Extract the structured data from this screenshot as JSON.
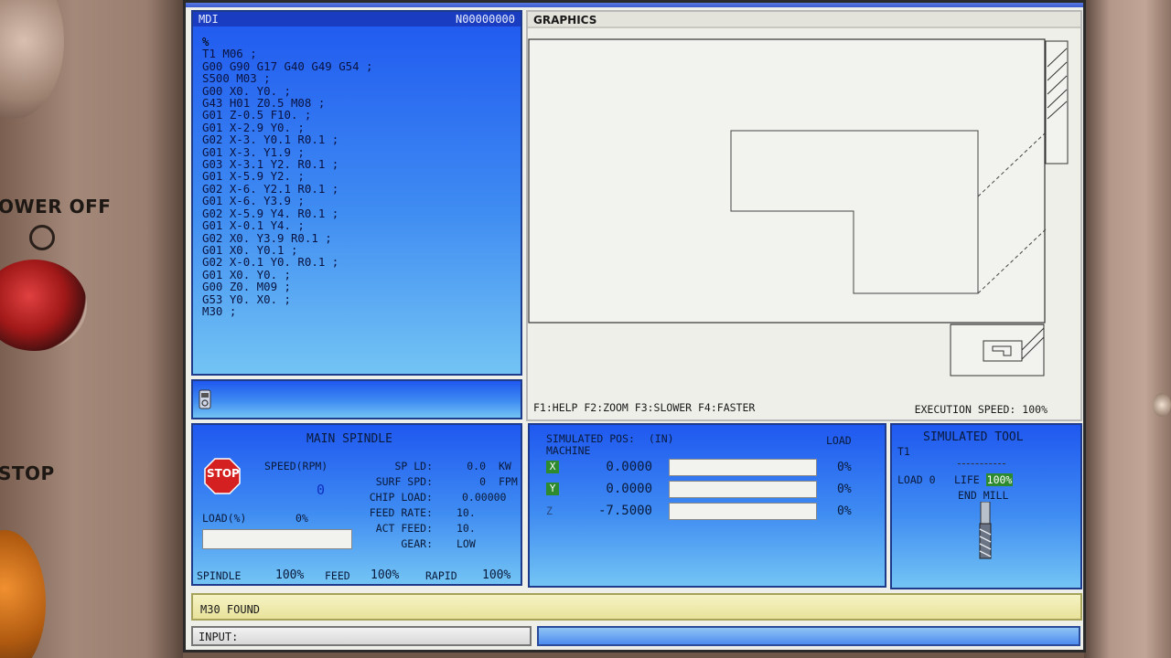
{
  "bezel": {
    "power_off_label": "OWER OFF",
    "stop_label": "STOP"
  },
  "mdi": {
    "title": "MDI",
    "program_number": "N00000000",
    "lines": [
      "%",
      "T1 M06 ;",
      "G00 G90 G17 G40 G49 G54 ;",
      "S500 M03 ;",
      "G00 X0. Y0. ;",
      "G43 H01 Z0.5 M08 ;",
      "G01 Z-0.5 F10. ;",
      "G01 X-2.9 Y0. ;",
      "G02 X-3. Y0.1 R0.1 ;",
      "G01 X-3. Y1.9 ;",
      "G03 X-3.1 Y2. R0.1 ;",
      "G01 X-5.9 Y2. ;",
      "G02 X-6. Y2.1 R0.1 ;",
      "G01 X-6. Y3.9 ;",
      "G02 X-5.9 Y4. R0.1 ;",
      "G01 X-0.1 Y4. ;",
      "G02 X0. Y3.9 R0.1 ;",
      "G01 X0. Y0.1 ;",
      "G02 X-0.1 Y0. R0.1 ;",
      "G01 X0. Y0. ;",
      "G00 Z0. M09 ;",
      "G53 Y0. X0. ;",
      "M30 ;"
    ]
  },
  "graphics": {
    "title": "GRAPHICS",
    "fkeys": "F1:HELP  F2:ZOOM  F3:SLOWER  F4:FASTER",
    "execution_speed_label": "EXECUTION SPEED:",
    "execution_speed_value": "100%"
  },
  "spindle": {
    "title": "MAIN SPINDLE",
    "stop_label": "STOP",
    "speed_label": "SPEED(RPM)",
    "speed_value": "0",
    "load_label": "LOAD(%)",
    "load_value": "0%",
    "load_fraction": 0,
    "stats": [
      {
        "label": "SP LD:",
        "value": "0.0",
        "unit": "KW"
      },
      {
        "label": "SURF SPD:",
        "value": "0",
        "unit": "FPM"
      },
      {
        "label": "CHIP LOAD:",
        "value": "0.00000",
        "unit": ""
      },
      {
        "label": "FEED RATE:",
        "value": "10.",
        "unit": ""
      },
      {
        "label": "ACT FEED:",
        "value": "10.",
        "unit": ""
      },
      {
        "label": "GEAR:",
        "value": "LOW",
        "unit": ""
      }
    ],
    "overrides": [
      {
        "label": "SPINDLE",
        "value": "100%"
      },
      {
        "label": "FEED",
        "value": "100%"
      },
      {
        "label": "RAPID",
        "value": "100%"
      }
    ]
  },
  "position": {
    "title": "SIMULATED POS:",
    "units": "(IN)",
    "mode": "MACHINE",
    "load_header": "LOAD",
    "axes": [
      {
        "name": "X",
        "value": "0.0000",
        "load": "0%",
        "load_fraction": 0
      },
      {
        "name": "Y",
        "value": "0.0000",
        "load": "0%",
        "load_fraction": 0
      },
      {
        "name": "Z",
        "value": "-7.5000",
        "load": "0%",
        "load_fraction": 0
      }
    ]
  },
  "tool": {
    "title": "SIMULATED TOOL",
    "tool_id": "T1",
    "load_label": "LOAD",
    "load_value": "0",
    "life_label": "LIFE",
    "life_value": "100%",
    "type": "END MILL"
  },
  "message": "M30 FOUND",
  "input_label": "INPUT:",
  "colors": {
    "panel_blue_top": "#1f58f0",
    "panel_blue_bottom": "#73c4f4",
    "message_yellow": "#f6f3c4",
    "axis_green": "#2e8a2e",
    "stop_red": "#d42020"
  }
}
